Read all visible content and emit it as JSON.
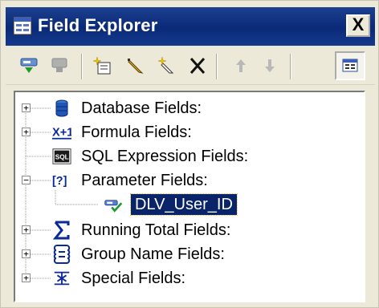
{
  "window": {
    "title": "Field Explorer",
    "close_label": "X"
  },
  "toolbar": {
    "buttons": [
      {
        "name": "insert-to-report-icon"
      },
      {
        "name": "browse-icon"
      },
      {
        "name": "new-icon"
      },
      {
        "name": "edit-icon"
      },
      {
        "name": "rename-icon"
      },
      {
        "name": "delete-icon"
      },
      {
        "name": "move-up-icon"
      },
      {
        "name": "move-down-icon"
      },
      {
        "name": "toggle-view-icon"
      }
    ]
  },
  "tree": {
    "items": [
      {
        "label": "Database Fields:",
        "expander": "+",
        "icon": "database-icon"
      },
      {
        "label": "Formula Fields:",
        "expander": "+",
        "icon": "formula-icon"
      },
      {
        "label": "SQL Expression Fields:",
        "expander": "",
        "icon": "sql-icon"
      },
      {
        "label": "Parameter Fields:",
        "expander": "−",
        "icon": "parameter-icon",
        "children": [
          {
            "label": "DLV_User_ID",
            "icon": "parameter-field-icon"
          }
        ]
      },
      {
        "label": "Running Total Fields:",
        "expander": "+",
        "icon": "running-total-icon"
      },
      {
        "label": "Group Name Fields:",
        "expander": "+",
        "icon": "group-name-icon"
      },
      {
        "label": "Special Fields:",
        "expander": "+",
        "icon": "special-fields-icon"
      }
    ]
  }
}
